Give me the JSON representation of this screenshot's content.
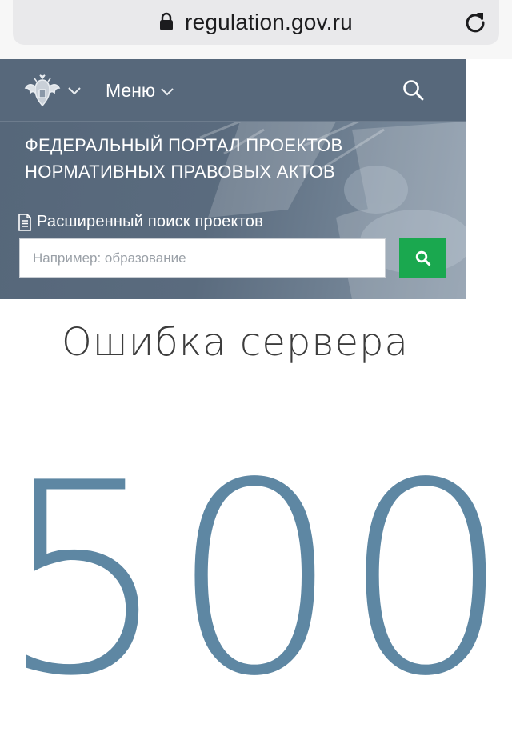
{
  "browser": {
    "url": "regulation.gov.ru",
    "icons": [
      "lock-icon",
      "reload-icon"
    ]
  },
  "header": {
    "menu_label": "Меню",
    "portal_title_line1": "ФЕДЕРАЛЬНЫЙ ПОРТАЛ ПРОЕКТОВ",
    "portal_title_line2": "НОРМАТИВНЫХ ПРАВОВЫХ АКТОВ",
    "advanced_search_label": "Расширенный поиск проектов",
    "search_placeholder": "Например: образование",
    "icons": [
      "emblem-icon",
      "chevron-down-icon",
      "search-icon",
      "document-icon"
    ]
  },
  "error": {
    "title": "Ошибка сервера",
    "code": "500"
  },
  "colors": {
    "header_bg": "#56677a",
    "search_button": "#1aa84f",
    "error_code": "#5e87a3",
    "error_title": "#3c3c3c"
  }
}
